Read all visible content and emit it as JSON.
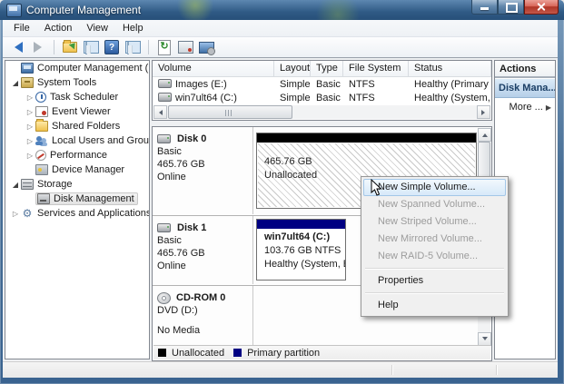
{
  "window": {
    "title": "Computer Management",
    "controls": {
      "minimize_icon": "minimize-bar",
      "maximize_icon": "maximize-square",
      "close_icon": "close-x"
    }
  },
  "menu_bar": {
    "items": [
      "File",
      "Action",
      "View",
      "Help"
    ]
  },
  "toolbar": {
    "icons": [
      "back-icon",
      "forward-icon",
      "export-folder-icon",
      "console-tree-icon",
      "help-icon",
      "action-pane-icon",
      "refresh-icon",
      "properties-icon",
      "rescan-disks-icon"
    ],
    "help_glyph": "?",
    "refresh_glyph": "↻"
  },
  "tree": {
    "items": [
      {
        "label": "Computer Management (Local",
        "icon": "computer-icon",
        "level": 0,
        "expander": "none",
        "selected": false
      },
      {
        "label": "System Tools",
        "icon": "system-tools-icon",
        "level": 1,
        "expander": "expanded",
        "selected": false
      },
      {
        "label": "Task Scheduler",
        "icon": "task-scheduler-icon",
        "level": 2,
        "expander": "collapsed",
        "selected": false
      },
      {
        "label": "Event Viewer",
        "icon": "event-viewer-icon",
        "level": 2,
        "expander": "collapsed",
        "selected": false
      },
      {
        "label": "Shared Folders",
        "icon": "shared-folders-icon",
        "level": 2,
        "expander": "collapsed",
        "selected": false
      },
      {
        "label": "Local Users and Groups",
        "icon": "local-users-groups-icon",
        "level": 2,
        "expander": "collapsed",
        "selected": false
      },
      {
        "label": "Performance",
        "icon": "performance-icon",
        "level": 2,
        "expander": "collapsed",
        "selected": false
      },
      {
        "label": "Device Manager",
        "icon": "device-manager-icon",
        "level": 2,
        "expander": "none",
        "selected": false
      },
      {
        "label": "Storage",
        "icon": "storage-icon",
        "level": 1,
        "expander": "expanded",
        "selected": false
      },
      {
        "label": "Disk Management",
        "icon": "disk-management-icon",
        "level": 2,
        "expander": "none",
        "selected": true
      },
      {
        "label": "Services and Applications",
        "icon": "services-applications-icon",
        "level": 1,
        "expander": "collapsed",
        "selected": false
      }
    ]
  },
  "volume_list": {
    "columns": [
      "Volume",
      "Layout",
      "Type",
      "File System",
      "Status"
    ],
    "rows": [
      [
        "Images (E:)",
        "Simple",
        "Basic",
        "NTFS",
        "Healthy (Primary Partition)"
      ],
      [
        "win7ult64 (C:)",
        "Simple",
        "Basic",
        "NTFS",
        "Healthy (System, Boot, Page"
      ]
    ]
  },
  "disks": [
    {
      "name": "Disk 0",
      "type": "Basic",
      "size": "465.76 GB",
      "status": "Online",
      "block": {
        "kind": "unallocated",
        "line1": "465.76 GB",
        "line2": "Unallocated"
      }
    },
    {
      "name": "Disk 1",
      "type": "Basic",
      "size": "465.76 GB",
      "status": "Online",
      "block": {
        "kind": "primary",
        "title": "win7ult64  (C:)",
        "line1": "103.76 GB NTFS",
        "line2": "Healthy (System, Boot, P"
      }
    },
    {
      "name": "CD-ROM 0",
      "line1": "DVD (D:)",
      "line2": "No Media"
    }
  ],
  "legend": {
    "items": [
      {
        "label": "Unallocated",
        "color": "#000000"
      },
      {
        "label": "Primary partition",
        "color": "#000082"
      }
    ]
  },
  "actions": {
    "header": "Actions",
    "group_label": "Disk Mana...",
    "group_collapse_glyph": "▲",
    "more_label": "More ...",
    "more_expand_glyph": "▶"
  },
  "context_menu": {
    "items": [
      {
        "label": "New Simple Volume...",
        "enabled": true,
        "highlighted": true
      },
      {
        "label": "New Spanned Volume...",
        "enabled": false
      },
      {
        "label": "New Striped Volume...",
        "enabled": false
      },
      {
        "label": "New Mirrored Volume...",
        "enabled": false
      },
      {
        "label": "New RAID-5 Volume...",
        "enabled": false
      },
      {
        "type": "separator"
      },
      {
        "label": "Properties",
        "enabled": true
      },
      {
        "type": "separator"
      },
      {
        "label": "Help",
        "enabled": true
      }
    ]
  },
  "colors": {
    "titlebar_blue": "#2f5a85",
    "close_button_red": "#b03526",
    "primary_partition_navy": "#000082",
    "unallocated_black": "#000000",
    "menu_highlight_blue": "#d7e9f9",
    "actions_selected_blue": "#b5cfe8"
  }
}
